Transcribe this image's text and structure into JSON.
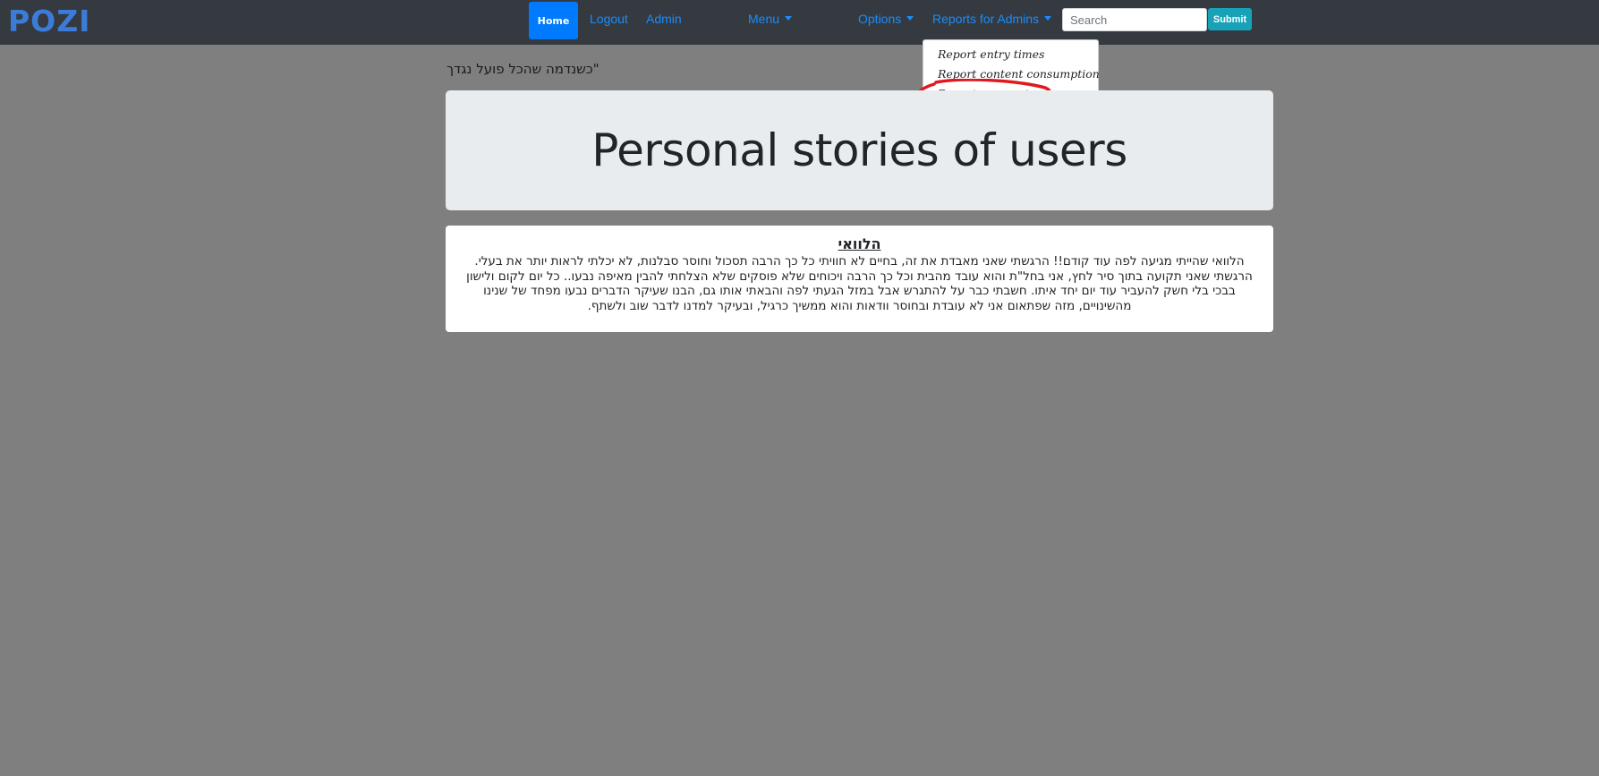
{
  "navbar": {
    "logo": "POZI",
    "home_label": "Home",
    "logout_label": "Logout",
    "admin_label": "Admin",
    "menu_label": "Menu",
    "options_label": "Options",
    "reports_label": "Reports for Admins",
    "search_placeholder": "Search",
    "submit_label": "Submit"
  },
  "reports_dropdown": {
    "items": [
      {
        "label": "Report entry times"
      },
      {
        "label": "Report content consumption"
      },
      {
        "label": "Report payments"
      }
    ],
    "highlighted_item": "Report payments",
    "highlight_color": "#e0191f"
  },
  "quote": "\"כשנדמה שהכל פועל נגדך",
  "jumbotron": {
    "title": "Personal stories of users"
  },
  "story": {
    "title": "הלוואי",
    "body": "הלוואי שהייתי מגיעה לפה עוד קודם!! הרגשתי שאני מאבדת את זה, בחיים לא חוויתי כל כך הרבה תסכול וחוסר סבלנות, לא יכלתי לראות יותר את בעלי. הרגשתי שאני תקועה בתוך סיר לחץ, אני בחל\"ת והוא עובד מהבית וכל כך הרבה ויכוחים שלא פוסקים שלא הצלחתי להבין מאיפה נבעו.. כל יום לקום ולישון בבכי בלי חשק להעביר עוד יום יחד איתו. חשבתי כבר על להתגרש אבל במזל הגעתי לפה והבאתי אותו גם, הבנו שעיקר הדברים נבעו מפחד של שנינו מהשינויים, מזה שפתאום אני לא עובדת ובחוסר וודאות והוא ממשיך כרגיל, ובעיקר למדנו לדבר שוב ולשתף."
  },
  "colors": {
    "navbar_bg": "#343a40",
    "page_bg": "#7f7f7f",
    "primary": "#007bff",
    "info": "#17a2b8",
    "logo": "#3d7bd9"
  }
}
